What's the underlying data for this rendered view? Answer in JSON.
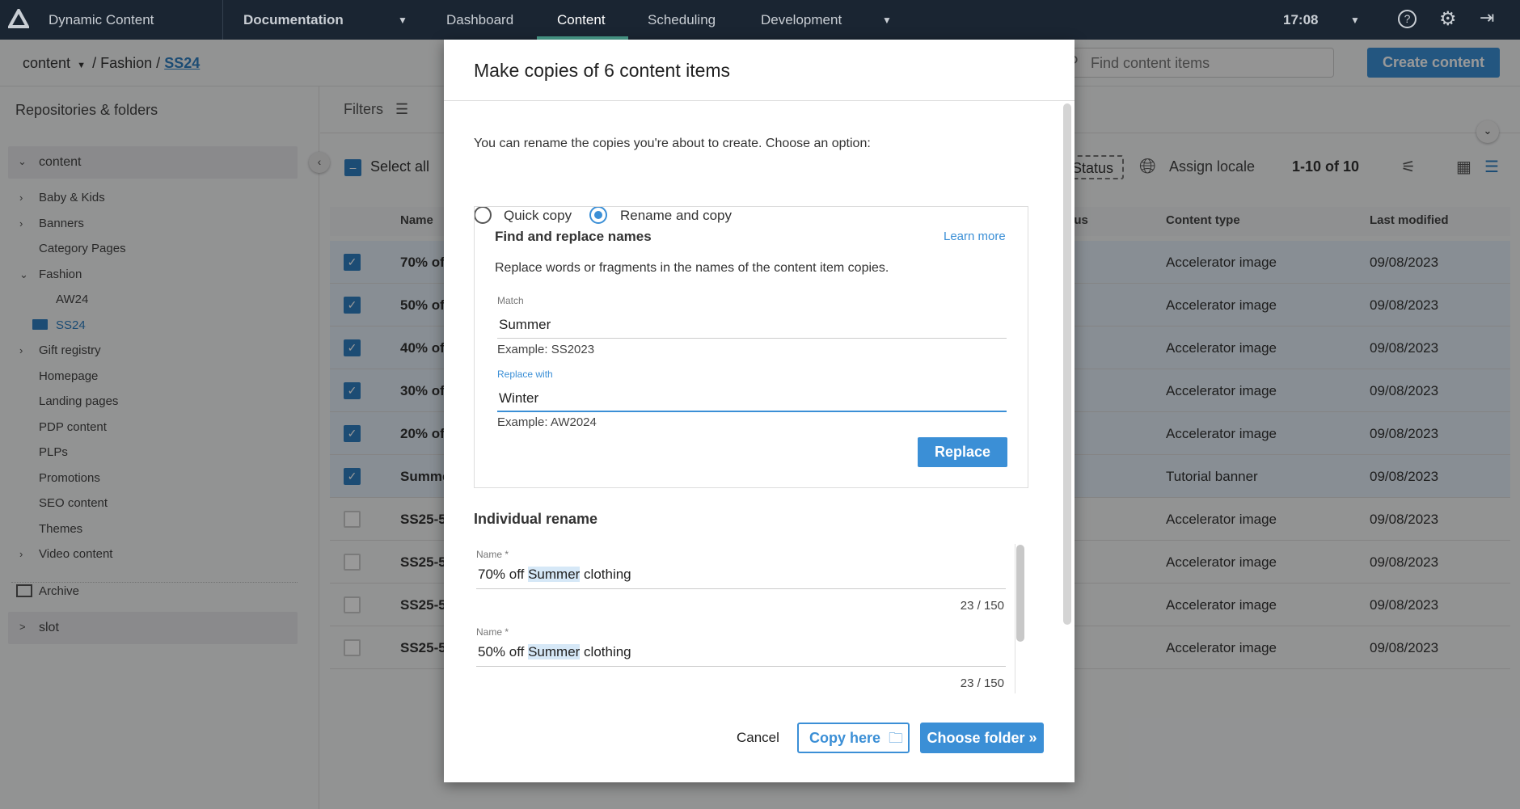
{
  "topbar": {
    "app_name": "Dynamic Content",
    "hub": "Documentation",
    "nav": [
      "Dashboard",
      "Content",
      "Scheduling",
      "Development"
    ],
    "active_nav": "Content",
    "time": "17:08",
    "accent": "#4a9e8c"
  },
  "breadcrumb": {
    "root": "content",
    "sep": "/",
    "folder": "Fashion",
    "current": "SS24"
  },
  "search": {
    "placeholder": "Find content items"
  },
  "create_label": "Create content",
  "sidebar": {
    "title": "Repositories & folders",
    "repo": "content",
    "items": [
      {
        "label": "Baby & Kids",
        "chev": ">",
        "level": 1
      },
      {
        "label": "Banners",
        "chev": ">",
        "level": 1
      },
      {
        "label": "Category Pages",
        "chev": "",
        "level": 1
      },
      {
        "label": "Fashion",
        "chev": "v",
        "level": 1
      },
      {
        "label": "AW24",
        "chev": "",
        "level": 2
      },
      {
        "label": "SS24",
        "chev": "",
        "level": 2,
        "selected": true
      },
      {
        "label": "Gift registry",
        "chev": ">",
        "level": 1
      },
      {
        "label": "Homepage",
        "chev": "",
        "level": 1
      },
      {
        "label": "Landing pages",
        "chev": "",
        "level": 1
      },
      {
        "label": "PDP content",
        "chev": "",
        "level": 1
      },
      {
        "label": "PLPs",
        "chev": "",
        "level": 1
      },
      {
        "label": "Promotions",
        "chev": "",
        "level": 1
      },
      {
        "label": "SEO content",
        "chev": "",
        "level": 1
      },
      {
        "label": "Themes",
        "chev": "",
        "level": 1
      },
      {
        "label": "Video content",
        "chev": ">",
        "level": 1
      }
    ],
    "archive": "Archive",
    "slot": "slot"
  },
  "list": {
    "filters": "Filters",
    "select_all": "Select all",
    "status_btn": "Status",
    "assign_locale": "Assign locale",
    "pagination": "1-10 of 10",
    "columns": {
      "name": "Name",
      "status": "Status",
      "type": "Content type",
      "modified": "Last modified"
    },
    "rows": [
      {
        "name": "70% of",
        "type": "Accelerator image",
        "modified": "09/08/2023",
        "checked": true
      },
      {
        "name": "50% of",
        "type": "Accelerator image",
        "modified": "09/08/2023",
        "checked": true
      },
      {
        "name": "40% of",
        "type": "Accelerator image",
        "modified": "09/08/2023",
        "checked": true
      },
      {
        "name": "30% of",
        "type": "Accelerator image",
        "modified": "09/08/2023",
        "checked": true
      },
      {
        "name": "20% of",
        "type": "Accelerator image",
        "modified": "09/08/2023",
        "checked": true
      },
      {
        "name": "Summe",
        "type": "Tutorial banner",
        "modified": "09/08/2023",
        "checked": true
      },
      {
        "name": "SS25-5",
        "type": "Accelerator image",
        "modified": "09/08/2023",
        "checked": false
      },
      {
        "name": "SS25-5",
        "type": "Accelerator image",
        "modified": "09/08/2023",
        "checked": false
      },
      {
        "name": "SS25-5",
        "type": "Accelerator image",
        "modified": "09/08/2023",
        "checked": false
      },
      {
        "name": "SS25-5",
        "type": "Accelerator image",
        "modified": "09/08/2023",
        "checked": false
      }
    ]
  },
  "modal": {
    "title": "Make copies of 6 content items",
    "intro": "You can rename the copies you're about to create. Choose an option:",
    "options": [
      "Quick copy",
      "Rename and copy"
    ],
    "selected_option": "Rename and copy",
    "find_replace": {
      "title": "Find and replace names",
      "learn_more": "Learn more",
      "description": "Replace words or fragments in the names of the content item copies.",
      "match_label": "Match",
      "match_value": "Summer",
      "match_hint": "Example: SS2023",
      "replace_label": "Replace with",
      "replace_value": "Winter",
      "replace_hint": "Example: AW2024",
      "replace_button": "Replace"
    },
    "individual": {
      "title": "Individual rename",
      "fields": [
        {
          "label": "Name *",
          "pre": "70% off ",
          "match": "Summer",
          "post": " clothing",
          "count": "23 / 150"
        },
        {
          "label": "Name *",
          "pre": "50% off ",
          "match": "Summer",
          "post": " clothing",
          "count": "23 / 150"
        }
      ]
    },
    "cancel": "Cancel",
    "copy_here": "Copy here",
    "choose_folder": "Choose folder »"
  }
}
